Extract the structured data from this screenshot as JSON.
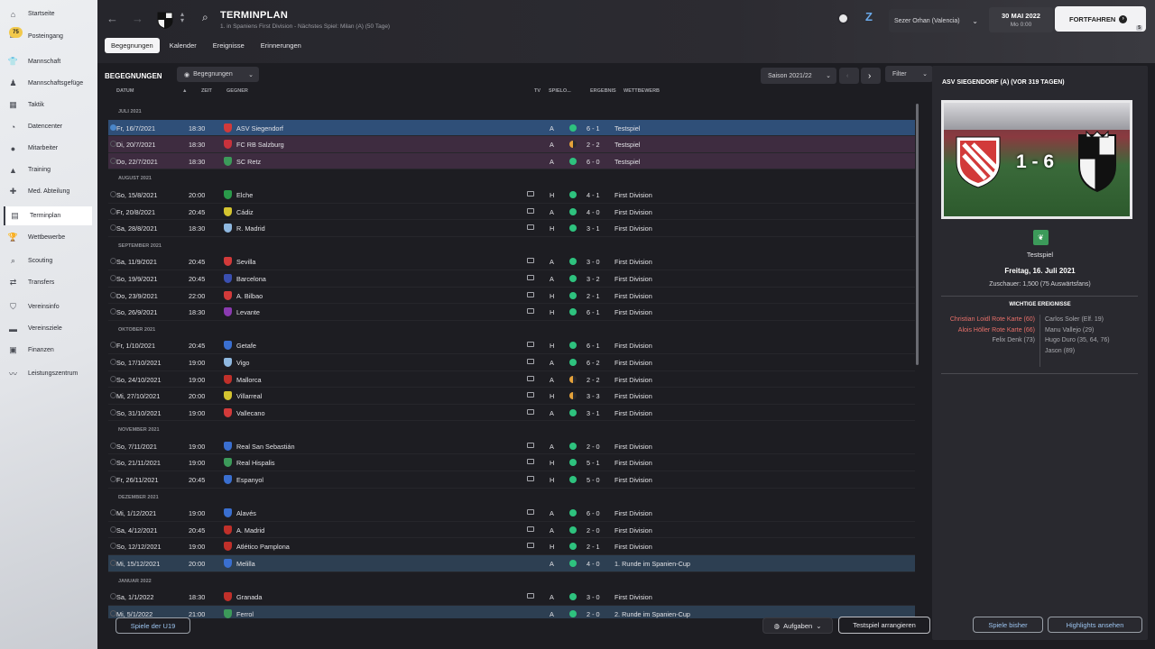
{
  "sidebar": {
    "badge": "75",
    "items": [
      {
        "label": "Startseite",
        "icon": "home-icon",
        "glyph": "⌂"
      },
      {
        "label": "Posteingang",
        "icon": "inbox-icon",
        "glyph": "✉"
      },
      {
        "label": "Mannschaft",
        "icon": "squad-icon",
        "glyph": "👕"
      },
      {
        "label": "Mannschaftsgefüge",
        "icon": "dynamics-icon",
        "glyph": "♟"
      },
      {
        "label": "Taktik",
        "icon": "tactics-icon",
        "glyph": "▦"
      },
      {
        "label": "Datencenter",
        "icon": "data-icon",
        "glyph": "◔"
      },
      {
        "label": "Mitarbeiter",
        "icon": "staff-icon",
        "glyph": "●"
      },
      {
        "label": "Training",
        "icon": "training-icon",
        "glyph": "▲"
      },
      {
        "label": "Med. Abteilung",
        "icon": "medical-icon",
        "glyph": "✚"
      },
      {
        "label": "Terminplan",
        "icon": "calendar-icon",
        "glyph": "▤"
      },
      {
        "label": "Wettbewerbe",
        "icon": "trophy-icon",
        "glyph": "🏆"
      },
      {
        "label": "Scouting",
        "icon": "scouting-icon",
        "glyph": "⌕"
      },
      {
        "label": "Transfers",
        "icon": "transfers-icon",
        "glyph": "⇄"
      },
      {
        "label": "Vereinsinfo",
        "icon": "club-info-icon",
        "glyph": "⛉"
      },
      {
        "label": "Vereinsziele",
        "icon": "club-vision-icon",
        "glyph": "▬"
      },
      {
        "label": "Finanzen",
        "icon": "finances-icon",
        "glyph": "▣"
      },
      {
        "label": "Leistungszentrum",
        "icon": "performance-icon",
        "glyph": "〰"
      }
    ]
  },
  "header": {
    "title": "TERMINPLAN",
    "subtitle": "1. in Spaniens First Division - Nächstes Spiel: Milan (A) (50 Tage)",
    "tabs": [
      "Begegnungen",
      "Kalender",
      "Ereignisse",
      "Erinnerungen"
    ],
    "manager": "Sezer Orhan (Valencia)",
    "date": "30 MAI 2022",
    "time": "Mo 0:00",
    "continue": "FORTFAHREN",
    "continue_count": "5"
  },
  "panel": {
    "title": "BEGEGNUNGEN",
    "view_dropdown": "Begegnungen",
    "season": "Saison 2021/22",
    "filter": "Filter",
    "columns": {
      "date": "DATUM",
      "time": "ZEIT",
      "opponent": "GEGNER",
      "tv": "TV",
      "venue": "SPIELO...",
      "result": "ERGEBNIS",
      "competition": "WETTBEWERB"
    },
    "u19_button": "Spiele der U19",
    "tasks_button": "Aufgaben",
    "arrange_button": "Testspiel arrangieren"
  },
  "fixtures": [
    {
      "month": "JULI 2021",
      "rows": [
        {
          "date": "Fr, 16/7/2021",
          "time": "18:30",
          "opp": "ASV Siegendorf",
          "tv": false,
          "venue": "A",
          "outcome": "win",
          "score": "6 - 1",
          "comp": "Testspiel",
          "crest": "#d23a3a",
          "hl": "sel"
        },
        {
          "date": "Di, 20/7/2021",
          "time": "18:30",
          "opp": "FC RB Salzburg",
          "tv": false,
          "venue": "A",
          "outcome": "draw",
          "score": "2 - 2",
          "comp": "Testspiel",
          "crest": "#c8323c",
          "hl": "friendly"
        },
        {
          "date": "Do, 22/7/2021",
          "time": "18:30",
          "opp": "SC Retz",
          "tv": false,
          "venue": "A",
          "outcome": "win",
          "score": "6 - 0",
          "comp": "Testspiel",
          "crest": "#3c9a5a",
          "hl": "friendly"
        }
      ]
    },
    {
      "month": "AUGUST 2021",
      "rows": [
        {
          "date": "So, 15/8/2021",
          "time": "20:00",
          "opp": "Elche",
          "tv": true,
          "venue": "H",
          "outcome": "win",
          "score": "4 - 1",
          "comp": "First Division",
          "crest": "#2a9a4a",
          "hl": ""
        },
        {
          "date": "Fr, 20/8/2021",
          "time": "20:45",
          "opp": "Cádiz",
          "tv": true,
          "venue": "A",
          "outcome": "win",
          "score": "4 - 0",
          "comp": "First Division",
          "crest": "#d4c430",
          "hl": ""
        },
        {
          "date": "Sa, 28/8/2021",
          "time": "18:30",
          "opp": "R. Madrid",
          "tv": true,
          "venue": "H",
          "outcome": "win",
          "score": "3 - 1",
          "comp": "First Division",
          "crest": "#8fb8e0",
          "hl": ""
        }
      ]
    },
    {
      "month": "SEPTEMBER 2021",
      "rows": [
        {
          "date": "Sa, 11/9/2021",
          "time": "20:45",
          "opp": "Sevilla",
          "tv": true,
          "venue": "A",
          "outcome": "win",
          "score": "3 - 0",
          "comp": "First Division",
          "crest": "#d23a3a",
          "hl": ""
        },
        {
          "date": "So, 19/9/2021",
          "time": "20:45",
          "opp": "Barcelona",
          "tv": true,
          "venue": "A",
          "outcome": "win",
          "score": "3 - 2",
          "comp": "First Division",
          "crest": "#3a4fb0",
          "hl": ""
        },
        {
          "date": "Do, 23/9/2021",
          "time": "22:00",
          "opp": "A. Bilbao",
          "tv": true,
          "venue": "H",
          "outcome": "win",
          "score": "2 - 1",
          "comp": "First Division",
          "crest": "#d23a3a",
          "hl": ""
        },
        {
          "date": "So, 26/9/2021",
          "time": "18:30",
          "opp": "Levante",
          "tv": true,
          "venue": "H",
          "outcome": "win",
          "score": "6 - 1",
          "comp": "First Division",
          "crest": "#8a3ab0",
          "hl": ""
        }
      ]
    },
    {
      "month": "OKTOBER 2021",
      "rows": [
        {
          "date": "Fr, 1/10/2021",
          "time": "20:45",
          "opp": "Getafe",
          "tv": true,
          "venue": "H",
          "outcome": "win",
          "score": "6 - 1",
          "comp": "First Division",
          "crest": "#3a6fd0",
          "hl": ""
        },
        {
          "date": "So, 17/10/2021",
          "time": "19:00",
          "opp": "Vigo",
          "tv": true,
          "venue": "A",
          "outcome": "win",
          "score": "6 - 2",
          "comp": "First Division",
          "crest": "#8fb8e0",
          "hl": ""
        },
        {
          "date": "So, 24/10/2021",
          "time": "19:00",
          "opp": "Mallorca",
          "tv": true,
          "venue": "A",
          "outcome": "draw",
          "score": "2 - 2",
          "comp": "First Division",
          "crest": "#c0302a",
          "hl": ""
        },
        {
          "date": "Mi, 27/10/2021",
          "time": "20:00",
          "opp": "Villarreal",
          "tv": true,
          "venue": "H",
          "outcome": "draw",
          "score": "3 - 3",
          "comp": "First Division",
          "crest": "#d4c430",
          "hl": ""
        },
        {
          "date": "So, 31/10/2021",
          "time": "19:00",
          "opp": "Vallecano",
          "tv": true,
          "venue": "A",
          "outcome": "win",
          "score": "3 - 1",
          "comp": "First Division",
          "crest": "#d23a3a",
          "hl": ""
        }
      ]
    },
    {
      "month": "NOVEMBER 2021",
      "rows": [
        {
          "date": "So, 7/11/2021",
          "time": "19:00",
          "opp": "Real San Sebastián",
          "tv": true,
          "venue": "A",
          "outcome": "win",
          "score": "2 - 0",
          "comp": "First Division",
          "crest": "#3a6fd0",
          "hl": ""
        },
        {
          "date": "So, 21/11/2021",
          "time": "19:00",
          "opp": "Real Hispalis",
          "tv": true,
          "venue": "H",
          "outcome": "win",
          "score": "5 - 1",
          "comp": "First Division",
          "crest": "#3c9a5a",
          "hl": ""
        },
        {
          "date": "Fr, 26/11/2021",
          "time": "20:45",
          "opp": "Espanyol",
          "tv": true,
          "venue": "H",
          "outcome": "win",
          "score": "5 - 0",
          "comp": "First Division",
          "crest": "#3a6fd0",
          "hl": ""
        }
      ]
    },
    {
      "month": "DEZEMBER 2021",
      "rows": [
        {
          "date": "Mi, 1/12/2021",
          "time": "19:00",
          "opp": "Alavés",
          "tv": true,
          "venue": "A",
          "outcome": "win",
          "score": "6 - 0",
          "comp": "First Division",
          "crest": "#3a6fd0",
          "hl": ""
        },
        {
          "date": "Sa, 4/12/2021",
          "time": "20:45",
          "opp": "A. Madrid",
          "tv": true,
          "venue": "A",
          "outcome": "win",
          "score": "2 - 0",
          "comp": "First Division",
          "crest": "#c0302a",
          "hl": ""
        },
        {
          "date": "So, 12/12/2021",
          "time": "19:00",
          "opp": "Atlético Pamplona",
          "tv": true,
          "venue": "H",
          "outcome": "win",
          "score": "2 - 1",
          "comp": "First Division",
          "crest": "#c0302a",
          "hl": ""
        },
        {
          "date": "Mi, 15/12/2021",
          "time": "20:00",
          "opp": "Melilla",
          "tv": false,
          "venue": "A",
          "outcome": "win",
          "score": "4 - 0",
          "comp": "1. Runde im Spanien-Cup",
          "crest": "#3a6fd0",
          "hl": "cup"
        }
      ]
    },
    {
      "month": "JANUAR 2022",
      "rows": [
        {
          "date": "Sa, 1/1/2022",
          "time": "18:30",
          "opp": "Granada",
          "tv": true,
          "venue": "A",
          "outcome": "win",
          "score": "3 - 0",
          "comp": "First Division",
          "crest": "#c0302a",
          "hl": ""
        },
        {
          "date": "Mi, 5/1/2022",
          "time": "21:00",
          "opp": "Ferrol",
          "tv": false,
          "venue": "A",
          "outcome": "win",
          "score": "2 - 0",
          "comp": "2. Runde im Spanien-Cup",
          "crest": "#3c9a5a",
          "hl": "cup"
        }
      ]
    }
  ],
  "detail": {
    "heading": "ASV SIEGENDORF (A) (VOR 319 TAGEN)",
    "score": "1 - 6",
    "competition": "Testspiel",
    "date": "Freitag, 16. Juli 2021",
    "attendance": "Zuschauer: 1,500 (75 Auswärtsfans)",
    "events_title": "WICHTIGE EREIGNISSE",
    "home_events": [
      {
        "text": "Christian Loidl Rote Karte (60)",
        "red": true
      },
      {
        "text": "Alois Höller Rote Karte (66)",
        "red": true
      },
      {
        "text": "Felix Denk (73)",
        "red": false
      }
    ],
    "away_events": [
      "Carlos Soler (Elf. 19)",
      "Manu Vallejo (29)",
      "Hugo Duro (35, 64, 76)",
      "Jason (89)"
    ],
    "btn_prev": "Spiele bisher",
    "btn_highlights": "Highlights ansehen"
  },
  "colors": {
    "win": "#2ec27e",
    "draw": "#e5a23a",
    "selected": "#2f4f78",
    "friendly": "#3e2c40",
    "cup": "#2d3f52",
    "accent": "#6aa9e9"
  }
}
